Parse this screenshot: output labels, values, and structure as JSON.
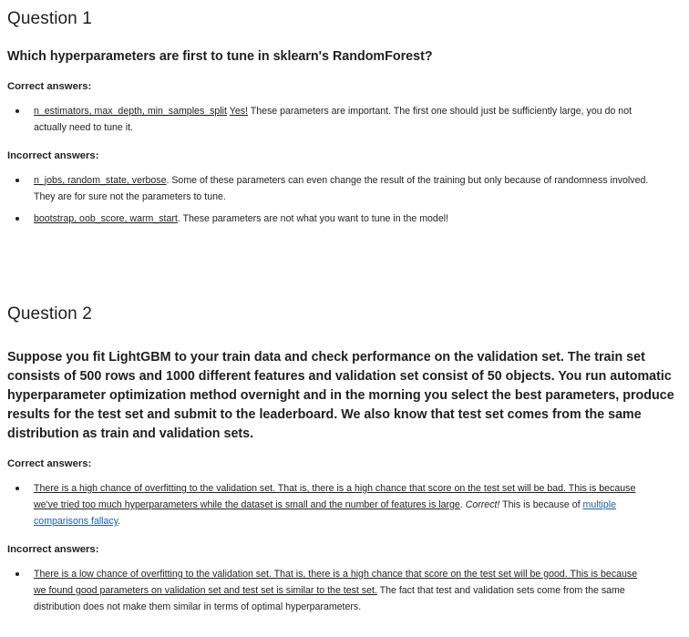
{
  "questions": [
    {
      "title": "Question 1",
      "text": "Which hyperparameters are first to tune in sklearn's RandomForest?",
      "correct_label": "Correct answers:",
      "correct": [
        {
          "choice": "n_estimators, max_depth, min_samples_split",
          "verdict": "Yes!",
          "explanation": "These parameters are important. The first one should just be sufficiently large, you do not actually need to tune it."
        }
      ],
      "incorrect_label": "Incorrect answers:",
      "incorrect": [
        {
          "choice": "n_jobs, random_state, verbose",
          "explanation": ". Some of these parameters can even change the result of the training but only because of randomness involved. They are for sure not the parameters to tune."
        },
        {
          "choice": "bootstrap, oob_score, warm_start",
          "explanation": ". These parameters are not what you want to tune in the model!"
        }
      ]
    },
    {
      "title": "Question 2",
      "text": "Suppose you fit LightGBM to your train data and check performance on the validation set. The train set consists of 500 rows and 1000 different features and validation set consist of 50 objects. You run automatic hyperparameter optimization method overnight and in the morning you select the best parameters, produce results for the test set and submit to the leaderboard. We also know that test set comes from the same distribution as train and validation sets.",
      "correct_label": "Correct answers:",
      "correct": [
        {
          "choice": "There is a high chance of overfitting to the validation set. That is, there is a high chance that score on the test set will be bad. This is because we've tried too much hyperparameters while the dataset is small and the number of features is large",
          "after_choice": ".",
          "verdict": "Correct!",
          "explanation": "This is because of",
          "link": "multiple comparisons fallacy",
          "end": "."
        }
      ],
      "incorrect_label": "Incorrect answers:",
      "incorrect": [
        {
          "choice": "There is a low chance of overfitting to the validation set. That is, there is a high chance that score on the test set will be good. This is because we found good parameters on validation set and test set is similar to the test set.",
          "explanation": "The fact that test and validation sets come from the same distribution does not make them similar in terms of optimal hyperparameters."
        }
      ]
    }
  ]
}
